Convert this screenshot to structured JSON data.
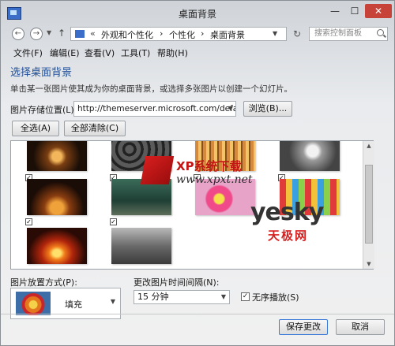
{
  "window": {
    "title": "桌面背景"
  },
  "address": {
    "prefix": "«",
    "crumbs": [
      "外观和个性化",
      "个性化",
      "桌面背景"
    ],
    "sep": "›",
    "search_placeholder": "搜索控制面板"
  },
  "menu": [
    "文件(F)",
    "编辑(E)",
    "查看(V)",
    "工具(T)",
    "帮助(H)"
  ],
  "content": {
    "heading": "选择桌面背景",
    "description": "单击某一张图片使其成为你的桌面背景，或选择多张图片以创建一个幻灯片。",
    "location_label": "图片存储位置(L):",
    "location_value": "http://themeserver.microsoft.com/defa",
    "browse_label": "浏览(B)...",
    "select_all_label": "全选(A)",
    "clear_all_label": "全部清除(C)"
  },
  "gallery": {
    "thumbnails": [
      {
        "name": "candle-light",
        "checked": false
      },
      {
        "name": "stones",
        "checked": false
      },
      {
        "name": "beads",
        "checked": false
      },
      {
        "name": "lightbulb",
        "checked": false
      },
      {
        "name": "fire-arch",
        "checked": true
      },
      {
        "name": "bicycle",
        "checked": true
      },
      {
        "name": "pink-bowls",
        "checked": true
      },
      {
        "name": "colored-cups",
        "checked": true
      },
      {
        "name": "campfire",
        "checked": true
      },
      {
        "name": "street-scene",
        "checked": true
      }
    ]
  },
  "watermarks": {
    "xp_text": "XP系统下载",
    "xp_url": "www.xpxt.net",
    "yesky": "yesky",
    "yesky_sub": "天极网"
  },
  "bottom": {
    "position_label": "图片放置方式(P):",
    "position_value": "填充",
    "interval_label": "更改图片时间间隔(N):",
    "interval_value": "15 分钟",
    "shuffle_label": "无序播放(S)",
    "shuffle_checked": true,
    "save_label": "保存更改",
    "cancel_label": "取消"
  },
  "colors": {
    "heading": "#1f4f9a",
    "close": "#c7433a"
  }
}
